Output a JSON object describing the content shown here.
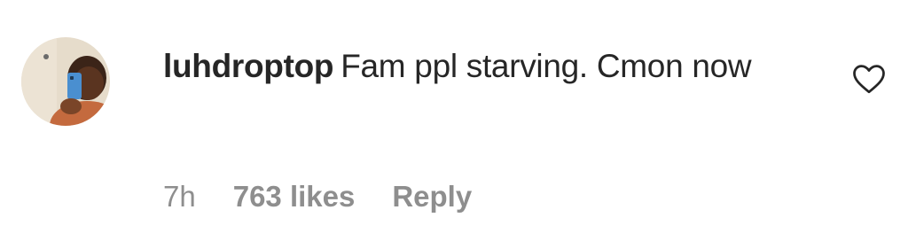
{
  "comment": {
    "username": "luhdroptop",
    "text": "Fam ppl starving. Cmon now",
    "time": "7h",
    "likes": "763 likes",
    "reply_label": "Reply",
    "avatar_icon": "user-avatar-photo",
    "like_icon": "heart-outline-icon",
    "liked": false
  },
  "colors": {
    "text_primary": "#262626",
    "text_secondary": "#8e8e8e",
    "background": "#ffffff"
  }
}
